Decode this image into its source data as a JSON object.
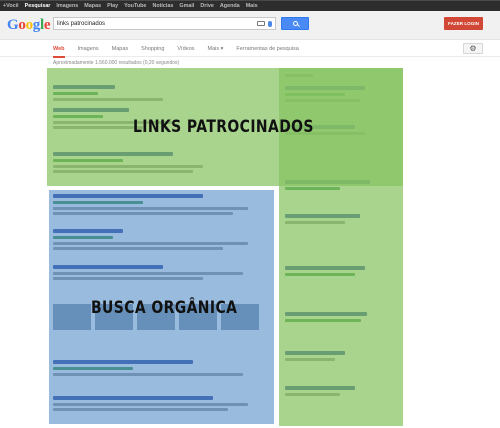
{
  "top_nav": {
    "items": [
      "+Você",
      "Pesquisar",
      "Imagens",
      "Mapas",
      "Play",
      "YouTube",
      "Notícias",
      "Gmail",
      "Drive",
      "Agenda",
      "Mais"
    ]
  },
  "header": {
    "logo": "Google",
    "search_query": "links patrocinados",
    "login_label": "FAZER LOGIN"
  },
  "tabs": {
    "items": [
      "Web",
      "Imagens",
      "Mapas",
      "Shopping",
      "Vídeos",
      "Mais ▾",
      "Ferramentas de pesquisa"
    ]
  },
  "results": {
    "stats": "Aproximadamente 1.560.000 resultados (0,20 segundos)"
  },
  "annotations": {
    "ads_label": "LINKS PATROCINADOS",
    "organic_label": "BUSCA ORGÂNICA"
  },
  "colors": {
    "ads_overlay": "#86c462",
    "organic_overlay": "#5a91c8",
    "accent_red": "#dd4b39",
    "search_blue": "#4a8af4"
  }
}
